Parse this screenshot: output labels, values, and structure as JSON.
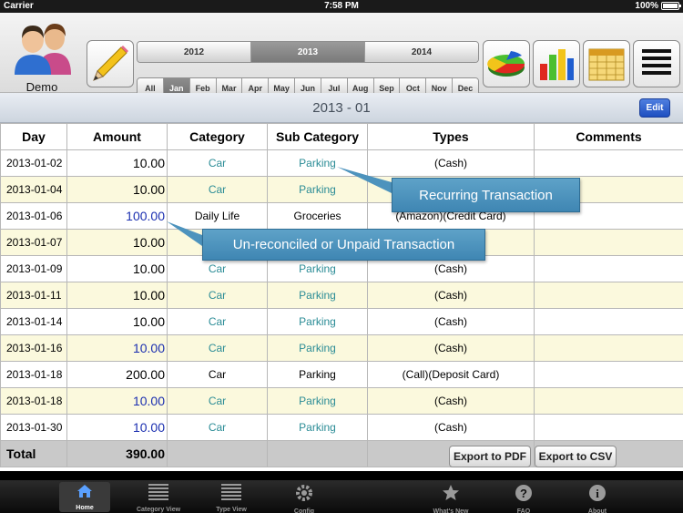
{
  "status_bar": {
    "carrier": "Carrier",
    "time": "7:58 PM",
    "battery": "100%",
    "battery_level": 1.0
  },
  "toolbar": {
    "profile_name": "Demo",
    "years": [
      "2012",
      "2013",
      "2014"
    ],
    "selected_year": "2013",
    "months": [
      "All",
      "Jan",
      "Feb",
      "Mar",
      "Apr",
      "May",
      "Jun",
      "Jul",
      "Aug",
      "Sep",
      "Oct",
      "Nov",
      "Dec"
    ],
    "selected_month": "Jan",
    "buttons": [
      "pencil-icon",
      "pie-chart-icon",
      "bar-chart-icon",
      "calendar-icon",
      "list-icon"
    ]
  },
  "title_bar": {
    "title": "2013 - 01",
    "edit_label": "Edit"
  },
  "table": {
    "headers": [
      "Day",
      "Amount",
      "Category",
      "Sub Category",
      "Types",
      "Comments"
    ],
    "rows": [
      {
        "day": "2013-01-02",
        "amount": "10.00",
        "category": "Car",
        "sub": "Parking",
        "types": "(Cash)",
        "comments": "",
        "blue": false,
        "teal": true
      },
      {
        "day": "2013-01-04",
        "amount": "10.00",
        "category": "Car",
        "sub": "Parking",
        "types": "",
        "comments": "",
        "blue": false,
        "teal": true
      },
      {
        "day": "2013-01-06",
        "amount": "100.00",
        "category": "Daily Life",
        "sub": "Groceries",
        "types": "(Amazon)(Credit Card)",
        "comments": "",
        "blue": true,
        "teal": false
      },
      {
        "day": "2013-01-07",
        "amount": "10.00",
        "category": "",
        "sub": "",
        "types": "",
        "comments": "",
        "blue": false,
        "teal": true
      },
      {
        "day": "2013-01-09",
        "amount": "10.00",
        "category": "Car",
        "sub": "Parking",
        "types": "(Cash)",
        "comments": "",
        "blue": false,
        "teal": true
      },
      {
        "day": "2013-01-11",
        "amount": "10.00",
        "category": "Car",
        "sub": "Parking",
        "types": "(Cash)",
        "comments": "",
        "blue": false,
        "teal": true
      },
      {
        "day": "2013-01-14",
        "amount": "10.00",
        "category": "Car",
        "sub": "Parking",
        "types": "(Cash)",
        "comments": "",
        "blue": false,
        "teal": true
      },
      {
        "day": "2013-01-16",
        "amount": "10.00",
        "category": "Car",
        "sub": "Parking",
        "types": "(Cash)",
        "comments": "",
        "blue": true,
        "teal": true
      },
      {
        "day": "2013-01-18",
        "amount": "200.00",
        "category": "Car",
        "sub": "Parking",
        "types": "(Call)(Deposit Card)",
        "comments": "",
        "blue": false,
        "teal": false
      },
      {
        "day": "2013-01-18",
        "amount": "10.00",
        "category": "Car",
        "sub": "Parking",
        "types": "(Cash)",
        "comments": "",
        "blue": true,
        "teal": true
      },
      {
        "day": "2013-01-30",
        "amount": "10.00",
        "category": "Car",
        "sub": "Parking",
        "types": "(Cash)",
        "comments": "",
        "blue": true,
        "teal": true
      }
    ],
    "total_label": "Total",
    "total_amount": "390.00",
    "export_pdf": "Export to PDF",
    "export_csv": "Export to CSV"
  },
  "callouts": {
    "recurring": "Recurring Transaction",
    "unreconciled": "Un-reconciled or Unpaid Transaction"
  },
  "tabbar": [
    {
      "label": "Home",
      "icon": "home-icon",
      "active": true
    },
    {
      "label": "Category View",
      "icon": "category-list-icon",
      "active": false
    },
    {
      "label": "Type View",
      "icon": "type-list-icon",
      "active": false
    },
    {
      "label": "Config",
      "icon": "gear-icon",
      "active": false
    },
    {
      "label": "What's New",
      "icon": "star-icon",
      "active": false
    },
    {
      "label": "FAQ",
      "icon": "question-icon",
      "active": false
    },
    {
      "label": "About",
      "icon": "info-icon",
      "active": false
    }
  ],
  "colors": {
    "teal_text": "#2b8c96",
    "blue_amount": "#1b2fb0",
    "alt_row": "#fbf9dd",
    "callout": "#4d93bd"
  }
}
